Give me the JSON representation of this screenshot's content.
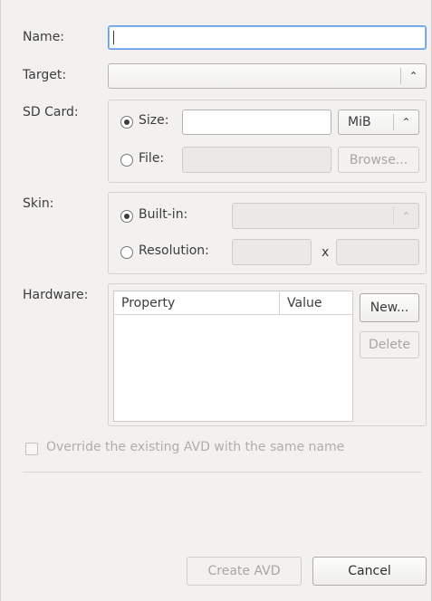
{
  "form": {
    "name_label": "Name:",
    "name_value": "",
    "target_label": "Target:",
    "target_value": "",
    "sdcard": {
      "label": "SD Card:",
      "size_label": "Size:",
      "size_value": "",
      "size_unit": "MiB",
      "file_label": "File:",
      "file_value": "",
      "browse_label": "Browse..."
    },
    "skin": {
      "label": "Skin:",
      "builtin_label": "Built-in:",
      "builtin_value": "",
      "resolution_label": "Resolution:",
      "res_width": "",
      "res_x": "x",
      "res_height": ""
    },
    "hardware": {
      "label": "Hardware:",
      "col_property": "Property",
      "col_value": "Value",
      "new_label": "New...",
      "delete_label": "Delete"
    },
    "override_label": "Override the existing AVD with the same name"
  },
  "footer": {
    "create_label": "Create AVD",
    "cancel_label": "Cancel"
  },
  "icons": {
    "combo_arrow": "updown-chevron-icon"
  }
}
